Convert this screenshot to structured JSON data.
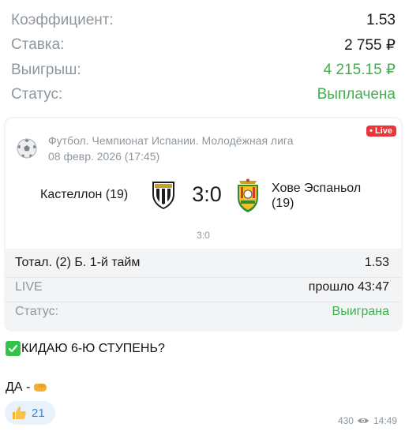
{
  "summary": {
    "rows": [
      {
        "label": "Коэффициент:",
        "value": "1.53"
      },
      {
        "label": "Ставка:",
        "value": "2 755 ₽"
      },
      {
        "label": "Выигрыш:",
        "value": "4 215.15 ₽"
      },
      {
        "label": "Статус:",
        "value": "Выплачена"
      }
    ]
  },
  "card": {
    "league": "Футбол. Чемпионат Испании. Молодёжная лига",
    "date": "08 февр. 2026 (17:45)",
    "live_badge": "• Live",
    "home_team": "Кастеллон (19)",
    "score": "3:0",
    "away_team": "Хове Эспаньол (19)",
    "sub_score": "3:0",
    "bet_name": "Тотал. (2) Б. 1-й тайм",
    "bet_odds": "1.53",
    "live_label": "LIVE",
    "elapsed": "прошло 43:47",
    "status_label": "Статус:",
    "status_value": "Выиграна"
  },
  "message": {
    "line1": "КИДАЮ 6-Ю СТУПЕНЬ?",
    "line2": "ДА -"
  },
  "reaction": {
    "emoji": "thumbs-up",
    "count": "21"
  },
  "meta": {
    "views": "430",
    "time": "14:49"
  },
  "colors": {
    "green": "#3fb14d",
    "live_red": "#e8363b",
    "link_blue": "#3a86d1"
  }
}
